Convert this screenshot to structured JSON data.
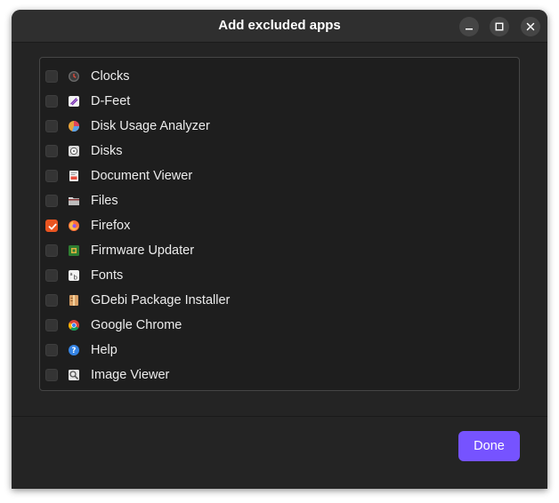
{
  "window": {
    "title": "Add excluded apps"
  },
  "titlebar_controls": [
    {
      "name": "minimize-icon"
    },
    {
      "name": "maximize-icon"
    },
    {
      "name": "close-icon"
    }
  ],
  "apps": [
    {
      "label": "Clocks",
      "checked": false,
      "icon": "clock-icon"
    },
    {
      "label": "D-Feet",
      "checked": false,
      "icon": "d-feet-icon"
    },
    {
      "label": "Disk Usage Analyzer",
      "checked": false,
      "icon": "pie-chart-icon"
    },
    {
      "label": "Disks",
      "checked": false,
      "icon": "disk-icon"
    },
    {
      "label": "Document Viewer",
      "checked": false,
      "icon": "document-icon"
    },
    {
      "label": "Files",
      "checked": false,
      "icon": "folder-icon"
    },
    {
      "label": "Firefox",
      "checked": true,
      "icon": "firefox-icon"
    },
    {
      "label": "Firmware Updater",
      "checked": false,
      "icon": "chip-icon"
    },
    {
      "label": "Fonts",
      "checked": false,
      "icon": "fonts-icon"
    },
    {
      "label": "GDebi Package Installer",
      "checked": false,
      "icon": "package-icon"
    },
    {
      "label": "Google Chrome",
      "checked": false,
      "icon": "chrome-icon"
    },
    {
      "label": "Help",
      "checked": false,
      "icon": "help-icon"
    },
    {
      "label": "Image Viewer",
      "checked": false,
      "icon": "image-viewer-icon"
    }
  ],
  "footer": {
    "done_label": "Done"
  },
  "colors": {
    "accent": "#7653ff",
    "check_accent": "#e95420",
    "window_bg": "#242424",
    "headerbar_bg": "#2f2f2f"
  }
}
